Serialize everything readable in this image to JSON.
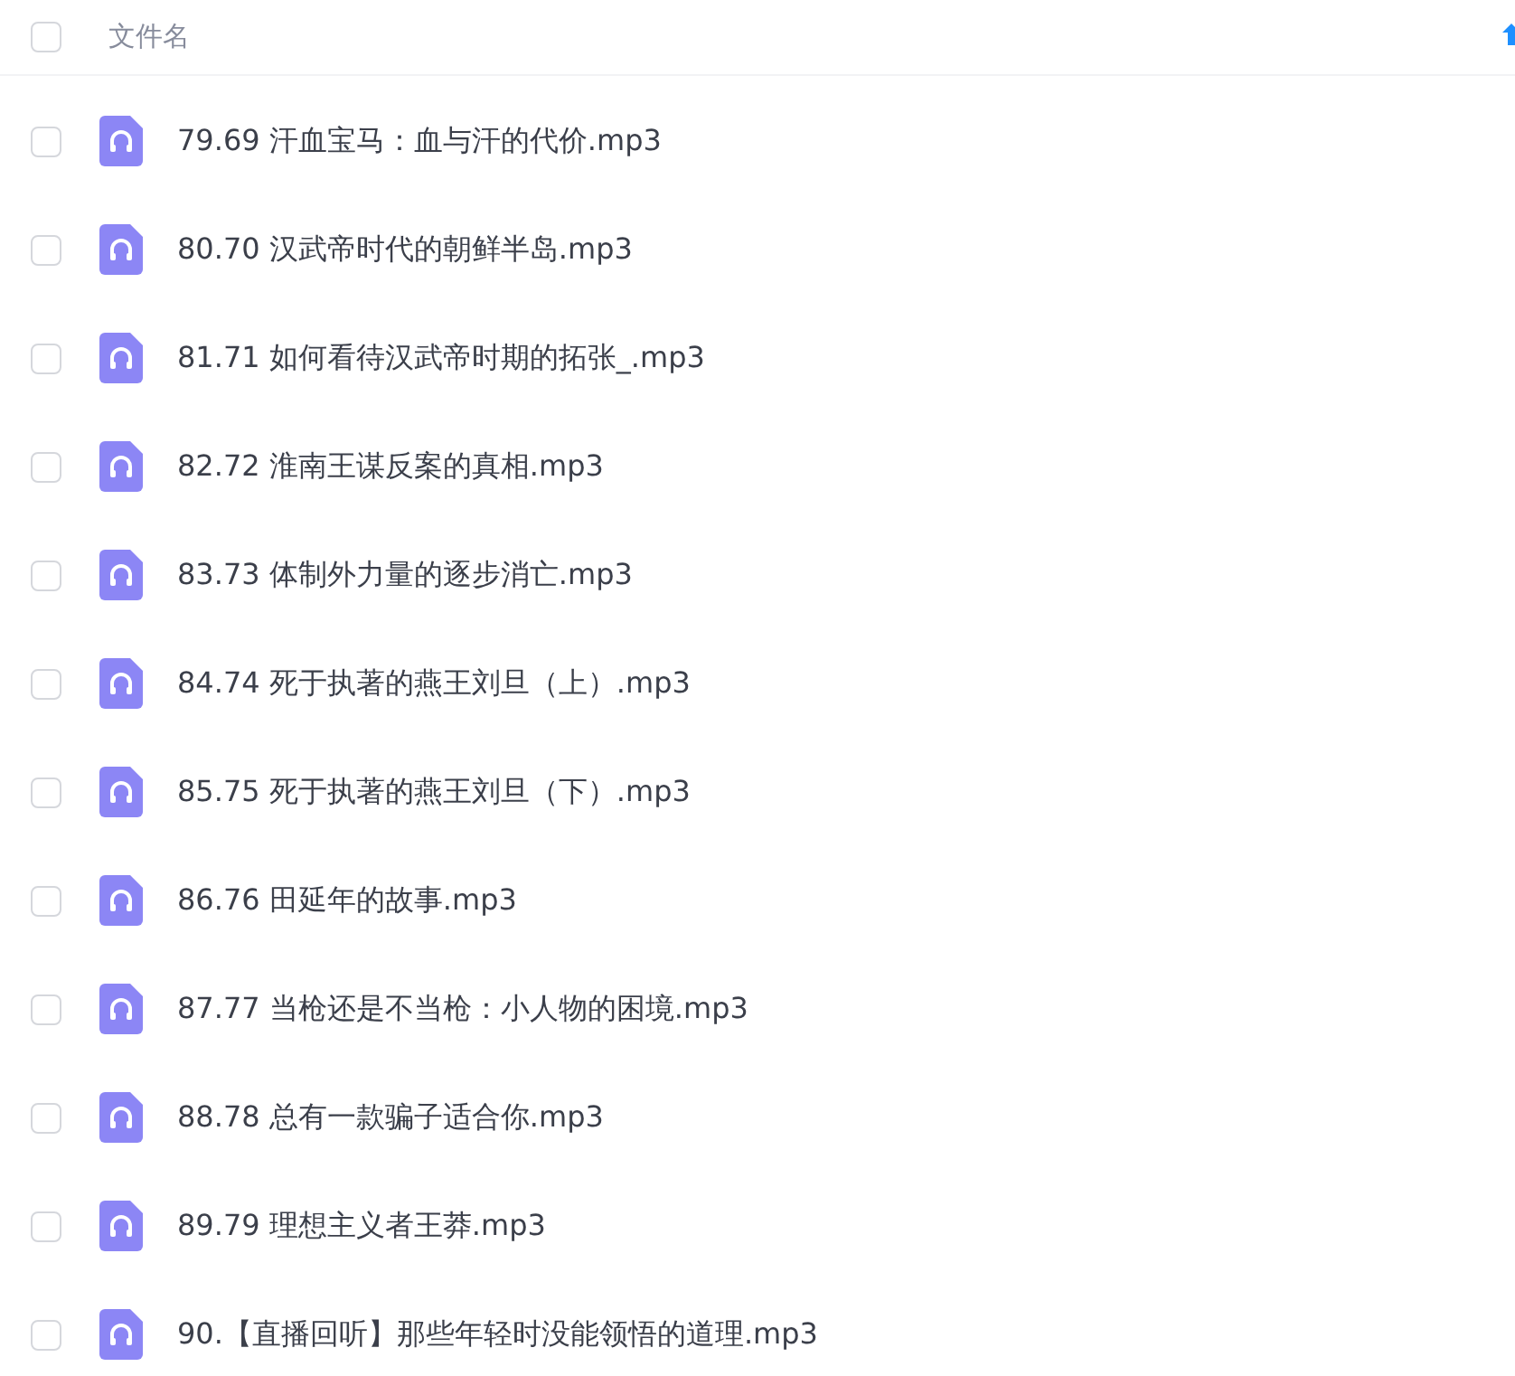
{
  "header": {
    "label": "文件名",
    "checked": false,
    "sort_ascending": true
  },
  "files": [
    {
      "name": "79.69 汗血宝马：血与汗的代价.mp3",
      "checked": false
    },
    {
      "name": "80.70 汉武帝时代的朝鲜半岛.mp3",
      "checked": false
    },
    {
      "name": "81.71 如何看待汉武帝时期的拓张_.mp3",
      "checked": false
    },
    {
      "name": "82.72 淮南王谋反案的真相.mp3",
      "checked": false
    },
    {
      "name": "83.73 体制外力量的逐步消亡.mp3",
      "checked": false
    },
    {
      "name": "84.74 死于执著的燕王刘旦（上）.mp3",
      "checked": false
    },
    {
      "name": "85.75 死于执著的燕王刘旦（下）.mp3",
      "checked": false
    },
    {
      "name": "86.76 田延年的故事.mp3",
      "checked": false
    },
    {
      "name": "87.77 当枪还是不当枪：小人物的困境.mp3",
      "checked": false
    },
    {
      "name": "88.78 总有一款骗子适合你.mp3",
      "checked": false
    },
    {
      "name": "89.79 理想主义者王莽.mp3",
      "checked": false
    },
    {
      "name": "90.【直播回听】那些年轻时没能领悟的道理.mp3",
      "checked": false
    }
  ]
}
